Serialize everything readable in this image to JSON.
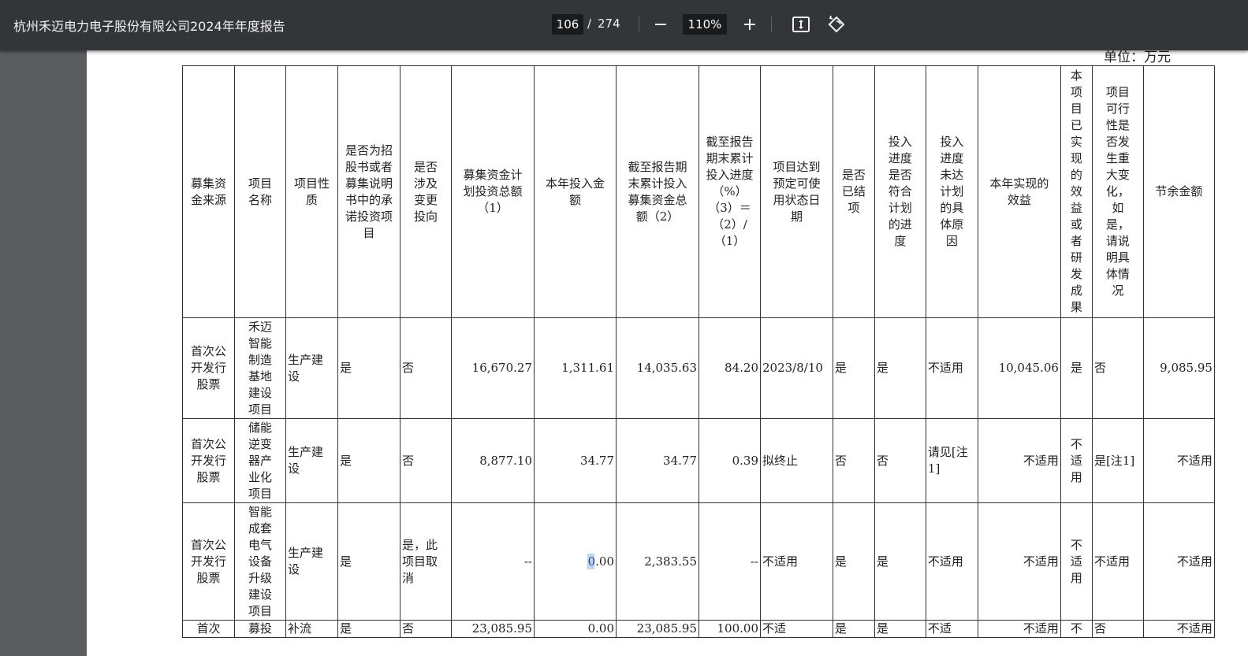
{
  "toolbar": {
    "title": "杭州禾迈电力电子股份有限公司2024年年度报告",
    "current_page": "106",
    "page_separator": "/",
    "total_pages": "274",
    "zoom": "110%",
    "icons": [
      "zoom-out-icon",
      "zoom-in-icon",
      "fit-page-icon",
      "rotate-icon"
    ]
  },
  "report": {
    "unit_label": "单位：万元",
    "headers": [
      "募集资金来源",
      "项目名称",
      "项目性质",
      "是否为招股书或者募集说明书中的承诺投资项目",
      "是否涉及变更投向",
      "募集资金计划投资总额（1）",
      "本年投入金额",
      "截至报告期末累计投入募集资金总额（2）",
      "截至报告期末累计投入进度（%）（3）＝（2）/（1）",
      "项目达到预定可使用状态日期",
      "是否已结项",
      "投入进度是否符合计划的进度",
      "投入进度未达计划的具体原因",
      "本年实现的效益",
      "本项目已实现的效益或者研发成果",
      "项目可行性是否发生重大变化，如是，请说明具体情况",
      "节余金额"
    ],
    "rows": [
      [
        "首次公开发行股票",
        "禾迈智能制造基地建设项目",
        "生产建设",
        "是",
        "否",
        "16,670.27",
        "1,311.61",
        "14,035.63",
        "84.20",
        "2023/8/10",
        "是",
        "是",
        "不适用",
        "10,045.06",
        "是",
        "否",
        "9,085.95"
      ],
      [
        "首次公开发行股票",
        "储能逆变器产业化项目",
        "生产建设",
        "是",
        "否",
        "8,877.10",
        "34.77",
        "34.77",
        "0.39",
        "拟终止",
        "否",
        "否",
        "请见[注1]",
        "不适用",
        "不适用",
        "是[注1]",
        "不适用"
      ],
      [
        "首次公开发行股票",
        "智能成套电气设备升级建设项目",
        "生产建设",
        "是",
        "是，此项目取消",
        "--",
        "0.00",
        "2,383.55",
        "--",
        "不适用",
        "是",
        "是",
        "不适用",
        "不适用",
        "不适用",
        "不适用",
        "不适用"
      ],
      [
        "首次",
        "募投",
        "补流",
        "是",
        "否",
        "23,085.95",
        "0.00",
        "23,085.95",
        "100.00",
        "不适",
        "是",
        "是",
        "不适",
        "不适用",
        "不",
        "否",
        "不适用"
      ]
    ]
  }
}
